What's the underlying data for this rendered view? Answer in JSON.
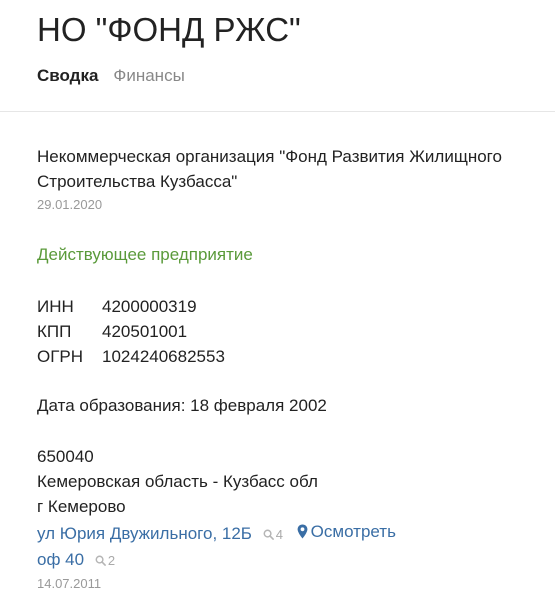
{
  "header": {
    "title": "НО \"ФОНД РЖС\"",
    "tabs": [
      {
        "label": "Сводка",
        "active": true
      },
      {
        "label": "Финансы",
        "active": false
      }
    ]
  },
  "org": {
    "full_name": "Некоммерческая организация \"Фонд Развития Жилищного Строительства Кузбасса\"",
    "name_date": "29.01.2020",
    "status": "Действующее предприятие",
    "codes": [
      {
        "label": "ИНН",
        "value": "4200000319"
      },
      {
        "label": "КПП",
        "value": "420501001"
      },
      {
        "label": "ОГРН",
        "value": "1024240682553"
      }
    ],
    "founded": "Дата образования: 18 февраля 2002"
  },
  "address": {
    "zip": "650040",
    "region": "Кемеровская область - Кузбасс обл",
    "city": "г Кемерово",
    "street": "ул Юрия Двужильного, 12Б",
    "street_count": "4",
    "map_label": "Осмотреть",
    "office": "оф 40",
    "office_count": "2",
    "date": "14.07.2011"
  },
  "colors": {
    "status": "#5a9a3a",
    "link": "#3a6ea5",
    "muted": "#999999"
  },
  "icons": {
    "search": "search-icon",
    "map": "map-pin-icon"
  }
}
